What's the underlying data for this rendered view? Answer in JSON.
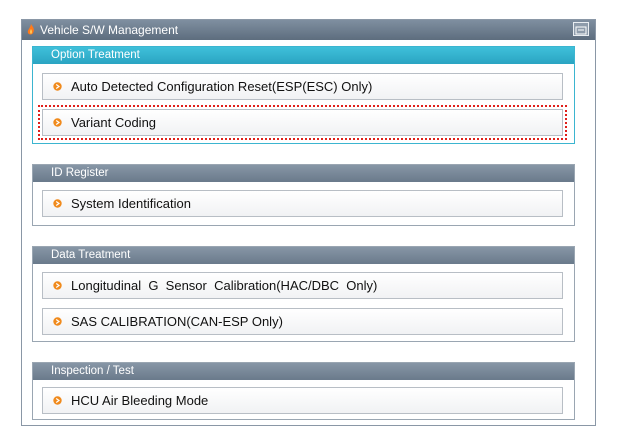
{
  "window": {
    "title": "Vehicle S/W Management"
  },
  "sections": [
    {
      "title": "Option Treatment",
      "items": [
        "Auto Detected Configuration Reset(ESP(ESC) Only)",
        "Variant Coding"
      ]
    },
    {
      "title": "ID Register",
      "items": [
        "System Identification"
      ]
    },
    {
      "title": "Data Treatment",
      "items": [
        "Longitudinal  G  Sensor  Calibration(HAC/DBC  Only)",
        "SAS CALIBRATION(CAN-ESP Only)"
      ]
    },
    {
      "title": "Inspection / Test",
      "items": [
        "HCU Air Bleeding Mode"
      ]
    }
  ],
  "colors": {
    "active_section": "#3bb5d0",
    "selection_outline": "#e0201b",
    "bullet": "#f08a1c"
  }
}
